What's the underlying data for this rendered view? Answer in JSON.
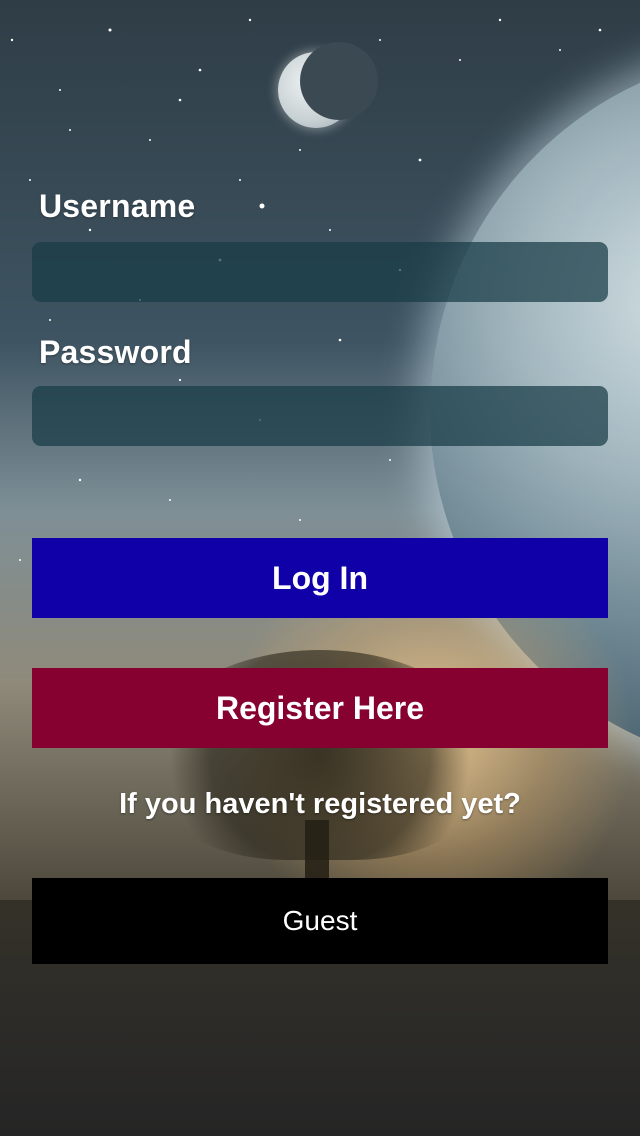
{
  "login_form": {
    "username_label": "Username",
    "username_value": "",
    "password_label": "Password",
    "password_value": "",
    "login_button_label": "Log In",
    "register_button_label": "Register Here",
    "register_hint": "If you haven't registered yet?",
    "guest_button_label": "Guest"
  },
  "colors": {
    "login_button": "#1000a8",
    "register_button": "#860030",
    "guest_button": "#000000",
    "input_background": "#183c46"
  }
}
